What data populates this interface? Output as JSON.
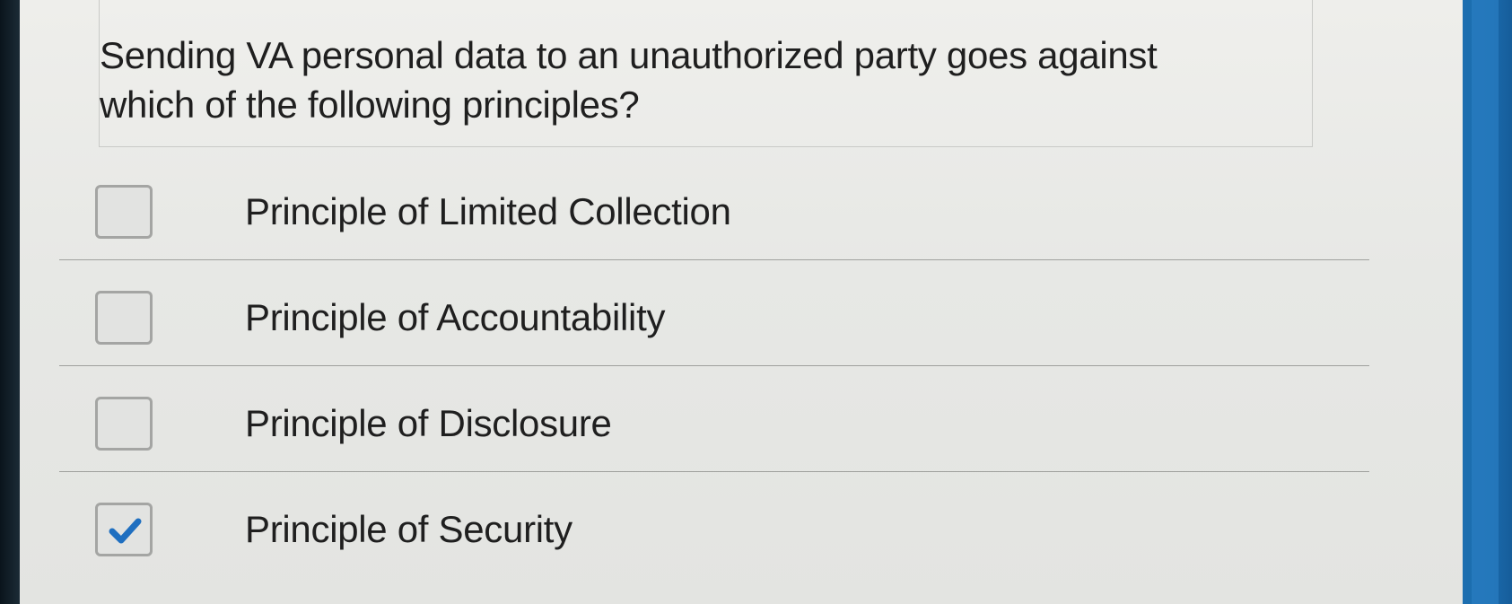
{
  "question": {
    "text": "Sending VA personal data to an unauthorized party goes against which of the following principles?"
  },
  "options": [
    {
      "label": "Principle of Limited Collection",
      "checked": false
    },
    {
      "label": "Principle of Accountability",
      "checked": false
    },
    {
      "label": "Principle of Disclosure",
      "checked": false
    },
    {
      "label": "Principle of Security",
      "checked": true
    }
  ],
  "colors": {
    "checkmark": "#1f6fc0",
    "scrollbar": "#1d6fb0"
  },
  "icons": {
    "checkmark": "checkmark-icon"
  }
}
